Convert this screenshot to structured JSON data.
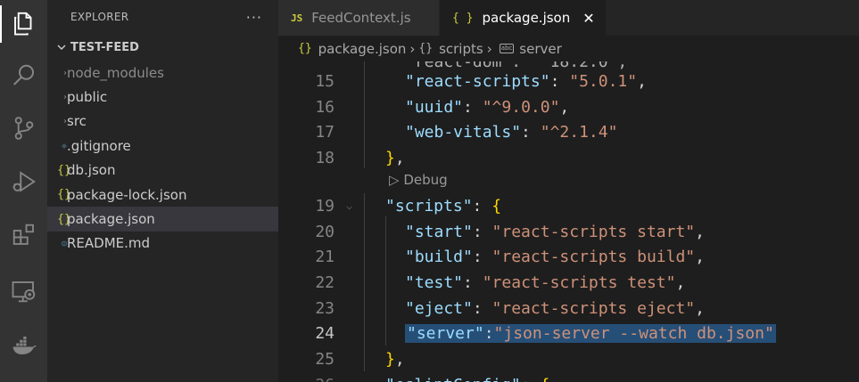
{
  "activity_bar": {
    "icons": [
      "explorer-icon",
      "search-icon",
      "source-control-icon",
      "run-debug-icon",
      "extensions-icon",
      "remote-explorer-icon",
      "docker-icon"
    ]
  },
  "sidebar": {
    "title": "EXPLORER",
    "more": "···",
    "root": "TEST-FEED",
    "items": [
      {
        "label": "node_modules",
        "type": "folder"
      },
      {
        "label": "public",
        "type": "folder"
      },
      {
        "label": "src",
        "type": "folder"
      },
      {
        "label": ".gitignore",
        "type": "file"
      },
      {
        "label": "db.json",
        "type": "file"
      },
      {
        "label": "package-lock.json",
        "type": "file"
      },
      {
        "label": "package.json",
        "type": "file"
      },
      {
        "label": "README.md",
        "type": "file"
      }
    ]
  },
  "tabs": [
    {
      "label": "FeedContext.js",
      "icon": "JS"
    },
    {
      "label": "package.json",
      "icon": "{ }",
      "close": "✕"
    }
  ],
  "breadcrumb": {
    "file": "package.json",
    "section": "scripts",
    "key": "server",
    "string_icon": "abc"
  },
  "editor": {
    "codelens": "Debug",
    "line_numbers": [
      "15",
      "16",
      "17",
      "18",
      "19",
      "20",
      "21",
      "22",
      "23",
      "24",
      "25"
    ],
    "lines": {
      "l15": {
        "key": "\"react-scripts\"",
        "value": "\"5.0.1\""
      },
      "l16": {
        "key": "\"uuid\"",
        "value": "\"^9.0.0\""
      },
      "l17": {
        "key": "\"web-vitals\"",
        "value": "\"^2.1.4\""
      },
      "l18": {
        "close": "}",
        "comma": ","
      },
      "l19": {
        "key": "\"scripts\"",
        "open": "{"
      },
      "l20": {
        "key": "\"start\"",
        "value": "\"react-scripts start\""
      },
      "l21": {
        "key": "\"build\"",
        "value": "\"react-scripts build\""
      },
      "l22": {
        "key": "\"test\"",
        "value": "\"react-scripts test\""
      },
      "l23": {
        "key": "\"eject\"",
        "value": "\"react-scripts eject\""
      },
      "l24": {
        "key": "\"server\"",
        "value": "\"json-server --watch db.json\""
      },
      "l25": {
        "close": "}",
        "comma": ","
      }
    },
    "current_line": "24"
  },
  "colors": {
    "activity_bar": "#333333",
    "sidebar": "#252526",
    "editor": "#1e1e1e",
    "selection": "#264f78",
    "json_key": "#9cdcfe",
    "json_string": "#ce9178",
    "bracket_level1": "#da70d6",
    "bracket_level2": "#ffd700"
  }
}
